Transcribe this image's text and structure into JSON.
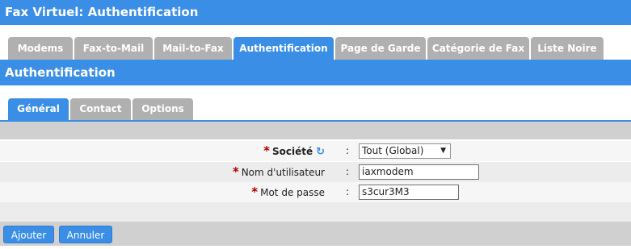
{
  "window": {
    "title": "Fax Virtuel:  Authentification"
  },
  "main_tabs": [
    {
      "label": "Modems",
      "active": false
    },
    {
      "label": "Fax-to-Mail",
      "active": false
    },
    {
      "label": "Mail-to-Fax",
      "active": false
    },
    {
      "label": "Authentification",
      "active": true
    },
    {
      "label": "Page de Garde",
      "active": false
    },
    {
      "label": "Catégorie de Fax",
      "active": false
    },
    {
      "label": "Liste Noire",
      "active": false
    }
  ],
  "section": {
    "title": "Authentification"
  },
  "sub_tabs": [
    {
      "label": "Général",
      "active": true
    },
    {
      "label": "Contact",
      "active": false
    },
    {
      "label": "Options",
      "active": false
    }
  ],
  "form": {
    "societe": {
      "label": "Société",
      "required_mark": "*",
      "colon": ":",
      "value": "Tout (Global)",
      "icon": "refresh-icon"
    },
    "nom_utilisateur": {
      "label": "Nom d'utilisateur",
      "required_mark": "*",
      "colon": ":",
      "value": "iaxmodem"
    },
    "mot_de_passe": {
      "label": "Mot de passe",
      "required_mark": "*",
      "colon": ":",
      "value": "s3cur3M3"
    }
  },
  "actions": {
    "add_label": "Ajouter",
    "cancel_label": "Annuler"
  },
  "colors": {
    "accent": "#3a8ee6",
    "tab_inactive": "#b0b0b0",
    "required": "#aa0000"
  }
}
